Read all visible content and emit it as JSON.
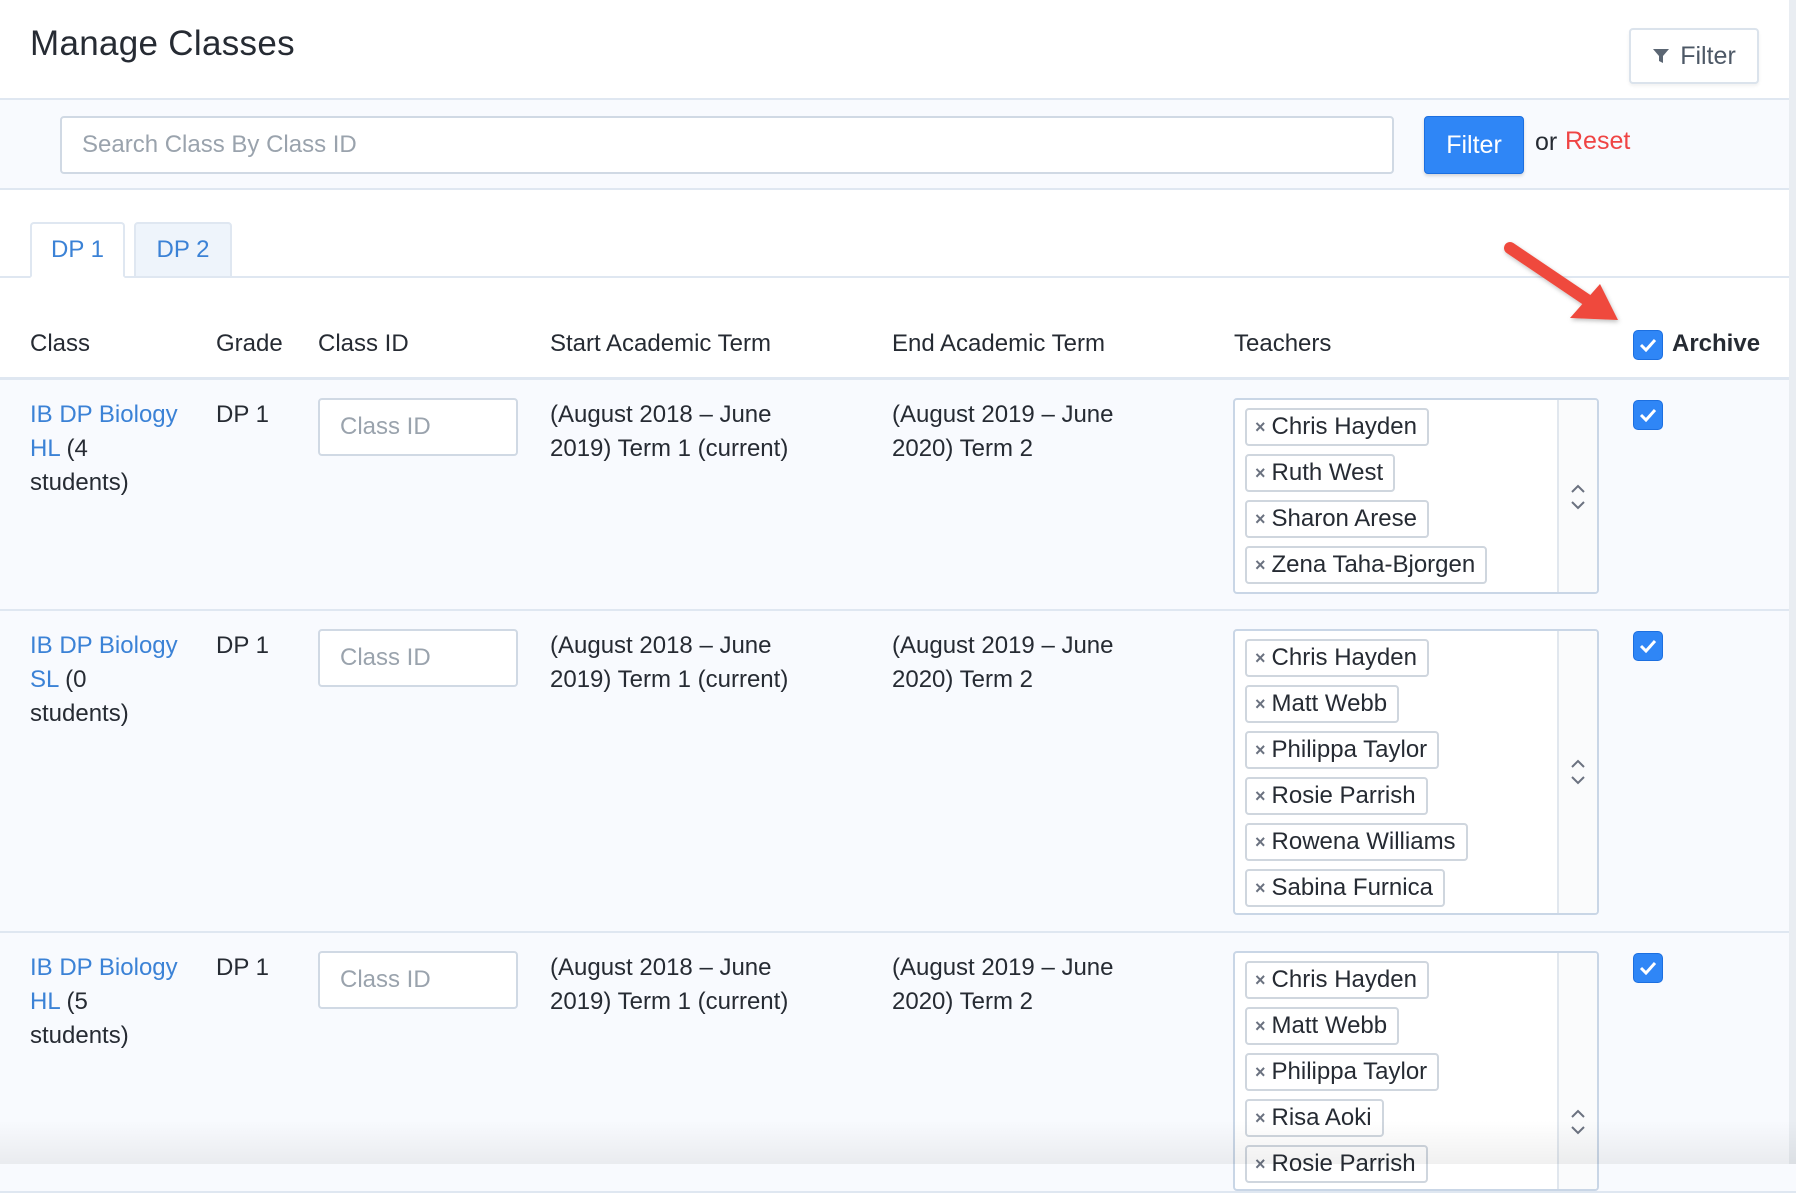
{
  "header": {
    "title": "Manage Classes",
    "filter_button": "Filter"
  },
  "search": {
    "placeholder": "Search Class By Class ID",
    "value": "",
    "filter_label": "Filter",
    "or_text": "or",
    "reset_label": "Reset"
  },
  "tabs": [
    {
      "label": "DP 1",
      "active": true
    },
    {
      "label": "DP 2",
      "active": false
    }
  ],
  "columns": {
    "class": "Class",
    "grade": "Grade",
    "class_id": "Class ID",
    "start_term": "Start Academic Term",
    "end_term": "End Academic Term",
    "teachers": "Teachers",
    "archive": "Archive"
  },
  "archive_all_checked": true,
  "rows": [
    {
      "class_link_line1": "IB DP Biology",
      "class_link_line2": "HL",
      "student_count_a": " (4",
      "student_count_b": "students)",
      "grade": "DP 1",
      "class_id_placeholder": "Class ID",
      "start_line1": "(August 2018 – June",
      "start_line2": "2019) Term 1 (current)",
      "end_line1": "(August 2019 – June",
      "end_line2": "2020) Term 2",
      "teachers": [
        "Chris Hayden",
        "Ruth West",
        "Sharon Arese",
        "Zena Taha-Bjorgen"
      ],
      "archived": true
    },
    {
      "class_link_line1": "IB DP Biology",
      "class_link_line2": "SL",
      "student_count_a": " (0",
      "student_count_b": "students)",
      "grade": "DP 1",
      "class_id_placeholder": "Class ID",
      "start_line1": "(August 2018 – June",
      "start_line2": "2019) Term 1 (current)",
      "end_line1": "(August 2019 – June",
      "end_line2": "2020) Term 2",
      "teachers": [
        "Chris Hayden",
        "Matt Webb",
        "Philippa Taylor",
        "Rosie Parrish",
        "Rowena Williams",
        "Sabina Furnica"
      ],
      "archived": true
    },
    {
      "class_link_line1": "IB DP Biology",
      "class_link_line2": "HL",
      "student_count_a": " (5",
      "student_count_b": "students)",
      "grade": "DP 1",
      "class_id_placeholder": "Class ID",
      "start_line1": "(August 2018 – June",
      "start_line2": "2019) Term 1 (current)",
      "end_line1": "(August 2019 – June",
      "end_line2": "2020) Term 2",
      "teachers": [
        "Chris Hayden",
        "Matt Webb",
        "Philippa Taylor",
        "Risa Aoki",
        "Rosie Parrish"
      ],
      "archived": true
    }
  ],
  "colors": {
    "accent": "#2f86f6",
    "link": "#3b82d6",
    "reset": "#ef4444",
    "annotation_arrow": "#ef4a3c"
  }
}
